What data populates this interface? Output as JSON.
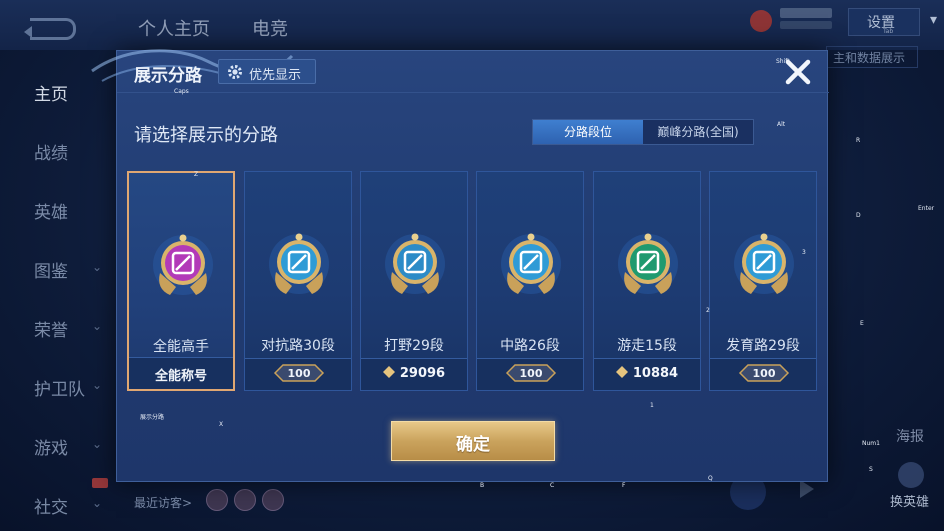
{
  "background": {
    "tabs": [
      "个人主页",
      "电竞"
    ],
    "settings_label": "设置",
    "settings_key": "Tab",
    "right_panel_text": "主和数据展示",
    "sidebar": [
      {
        "label": "主页",
        "active": true
      },
      {
        "label": "战绩"
      },
      {
        "label": "英雄"
      },
      {
        "label": "图鉴",
        "chevron": true
      },
      {
        "label": "荣誉",
        "chevron": true
      },
      {
        "label": "护卫队",
        "chevron": true
      },
      {
        "label": "游戏",
        "chevron": true
      },
      {
        "label": "社交",
        "chevron": true
      }
    ],
    "recent_visitors_label": "最近访客>",
    "sea_report": "海报",
    "swap_hero": "换英雄"
  },
  "modal": {
    "title": "展示分路",
    "priority_button": "优先显示",
    "prompt": "请选择展示的分路",
    "segments": [
      {
        "label": "分路段位",
        "active": true
      },
      {
        "label": "巅峰分路(全国)",
        "active": false
      }
    ],
    "cards": [
      {
        "name": "全能高手",
        "footer_type": "text",
        "footer": "全能称号",
        "selected": true,
        "color": "#b23ab8"
      },
      {
        "name": "对抗路30段",
        "footer_type": "badge",
        "footer": "100",
        "selected": false,
        "color": "#2f9bd6"
      },
      {
        "name": "打野29段",
        "footer_type": "score",
        "footer": "29096",
        "selected": false,
        "color": "#2c8bc7"
      },
      {
        "name": "中路26段",
        "footer_type": "badge",
        "footer": "100",
        "selected": false,
        "color": "#2f9bd6"
      },
      {
        "name": "游走15段",
        "footer_type": "score",
        "footer": "10884",
        "selected": false,
        "color": "#1f9a6f"
      },
      {
        "name": "发育路29段",
        "footer_type": "badge",
        "footer": "100",
        "selected": false,
        "color": "#2f9bd6"
      }
    ],
    "confirm_label": "确定"
  },
  "key_hints": [
    {
      "text": "Caps"
    },
    {
      "text": "Shift"
    },
    {
      "text": "Alt"
    },
    {
      "text": "R"
    },
    {
      "text": "D"
    },
    {
      "text": "Enter"
    },
    {
      "text": "3"
    },
    {
      "text": "Z"
    },
    {
      "text": "2"
    },
    {
      "text": "E"
    },
    {
      "text": "1"
    },
    {
      "text": "X"
    },
    {
      "text": "展示分路"
    },
    {
      "text": "Num1"
    },
    {
      "text": "S"
    },
    {
      "text": "Q"
    },
    {
      "text": "B"
    },
    {
      "text": "C"
    },
    {
      "text": "F"
    }
  ]
}
